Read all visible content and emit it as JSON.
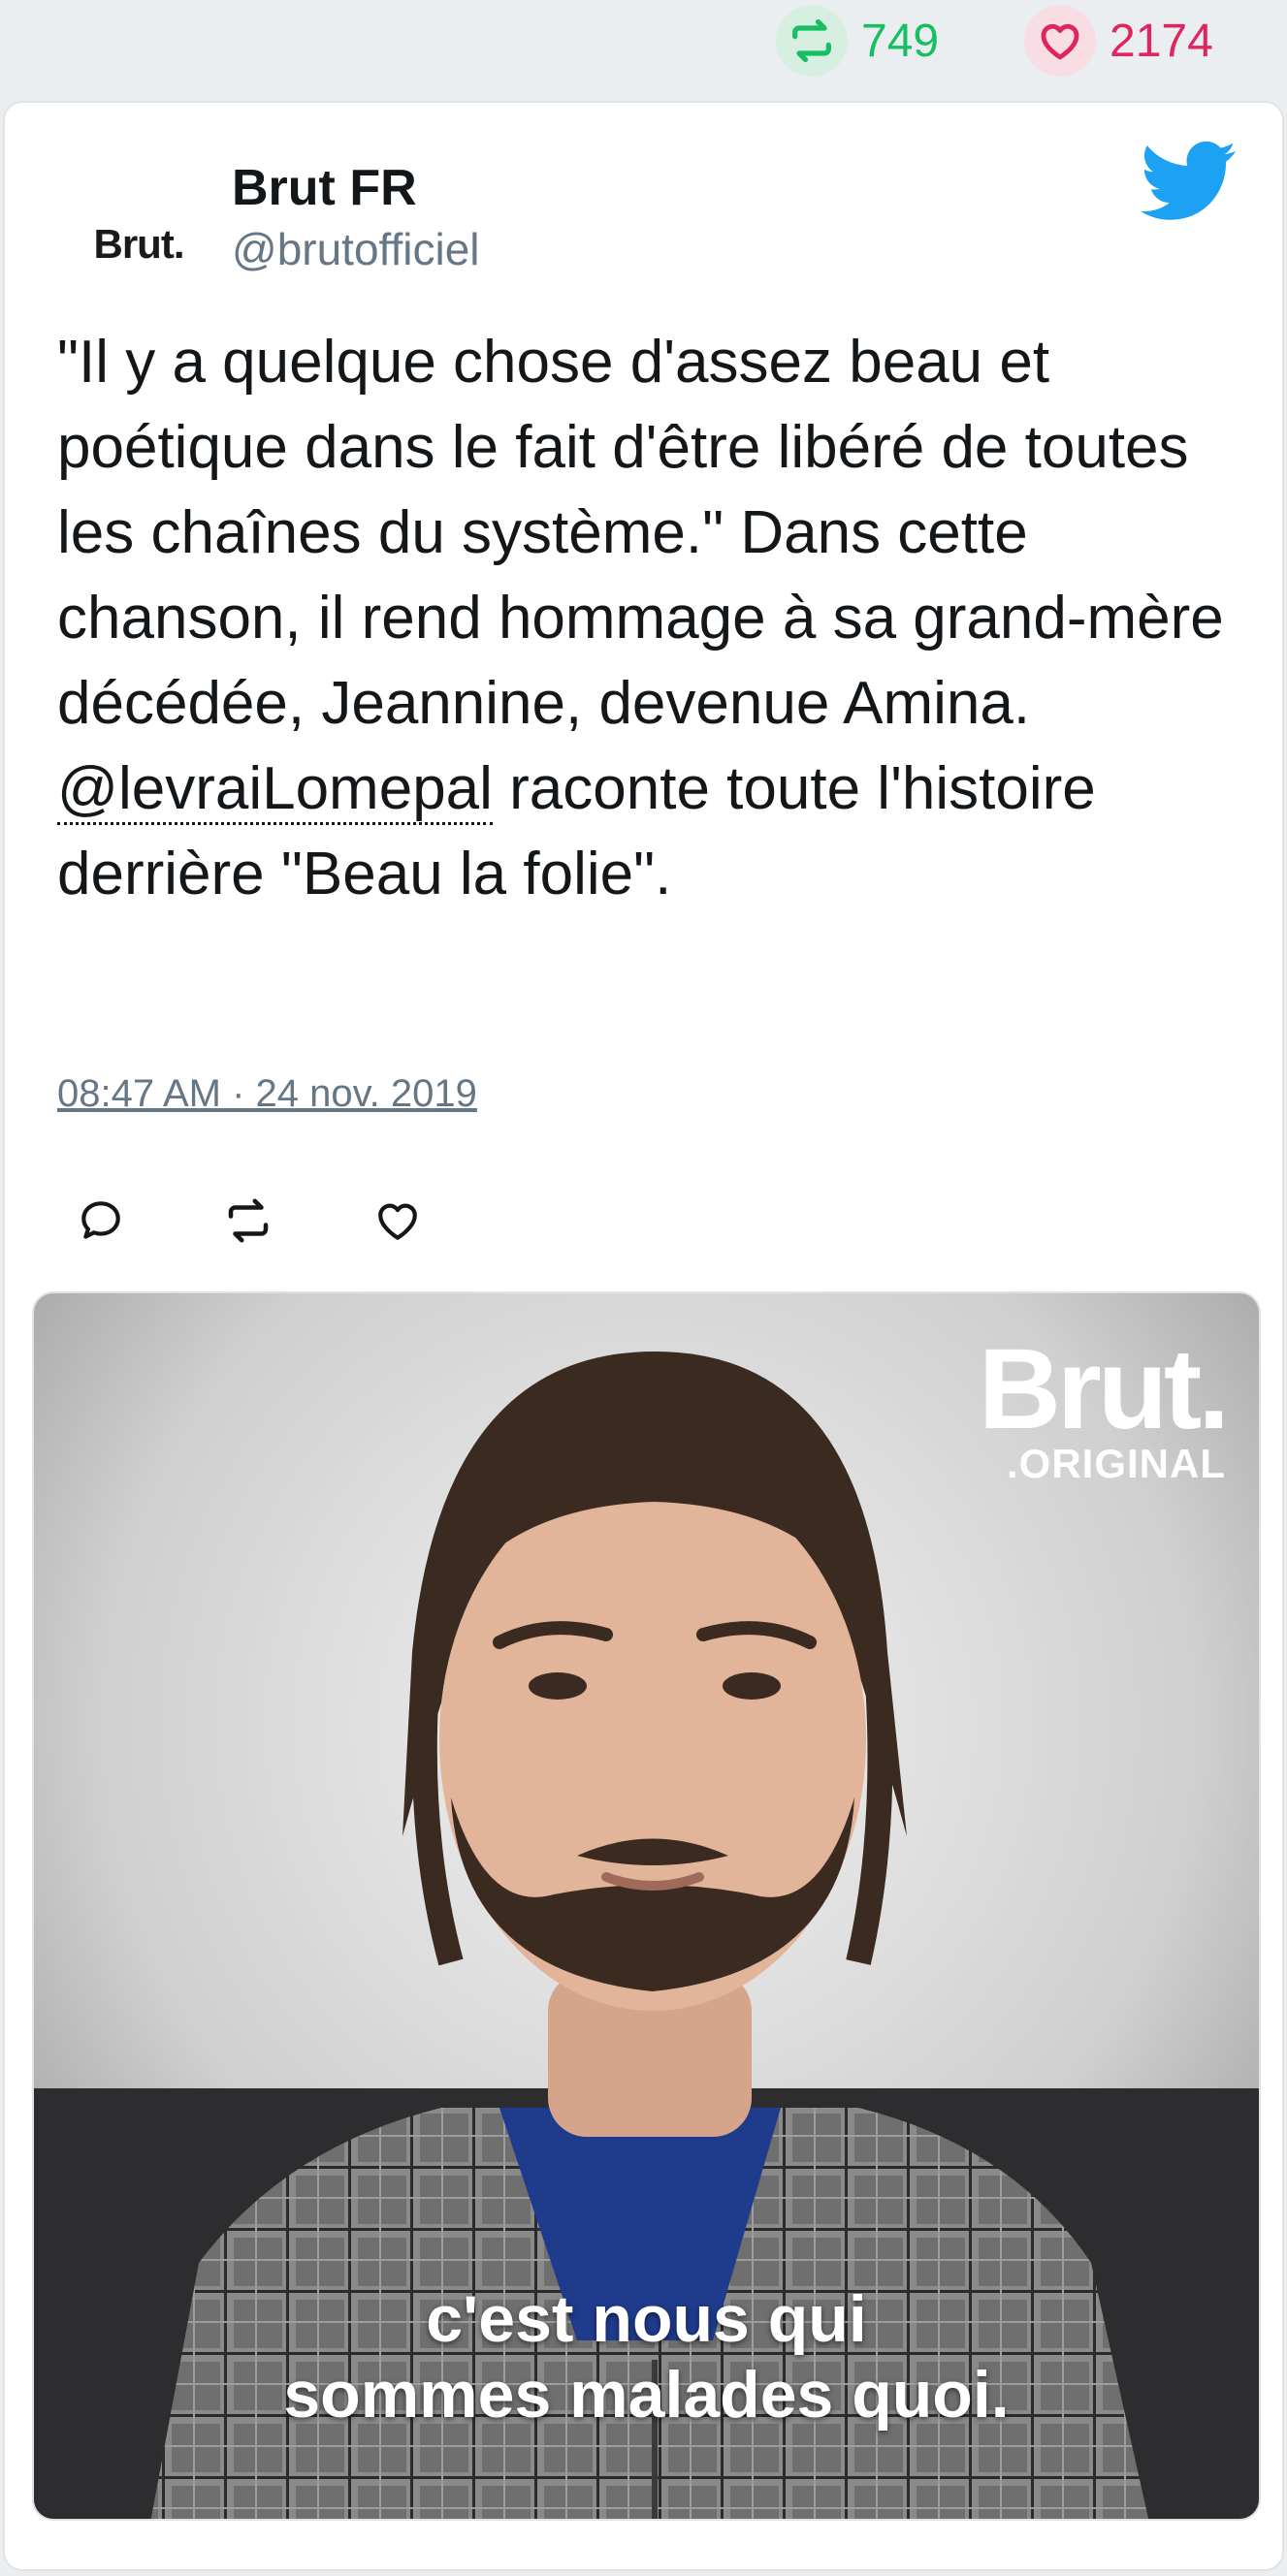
{
  "stats": {
    "retweets": "749",
    "likes": "2174"
  },
  "tweet": {
    "author_name": "Brut FR",
    "author_handle": "@brutofficiel",
    "avatar_text": "Brut.",
    "text_before": "\"Il y a quelque chose d'assez beau et poétique dans le fait d'être libéré de toutes les chaînes du système.\" Dans cette chanson, il rend hommage à sa grand-mère décédée, Jeannine, devenue Amina. ",
    "mention": "@levraiLomepal",
    "text_after": " raconte toute l'histoire derrière \"Beau la folie\".",
    "timestamp": "08:47 AM · 24 nov. 2019"
  },
  "media": {
    "logo_main": "Brut.",
    "logo_sub": ".ORIGINAL",
    "subtitle_line1": "c'est nous qui",
    "subtitle_line2": "sommes malades quoi."
  },
  "colors": {
    "retweet_green": "#17bf63",
    "like_red": "#e0245e",
    "twitter_blue": "#1da1f2",
    "muted_gray": "#657786"
  },
  "icons": [
    "retweet-icon",
    "heart-icon",
    "twitter-bird-icon",
    "reply-icon"
  ]
}
